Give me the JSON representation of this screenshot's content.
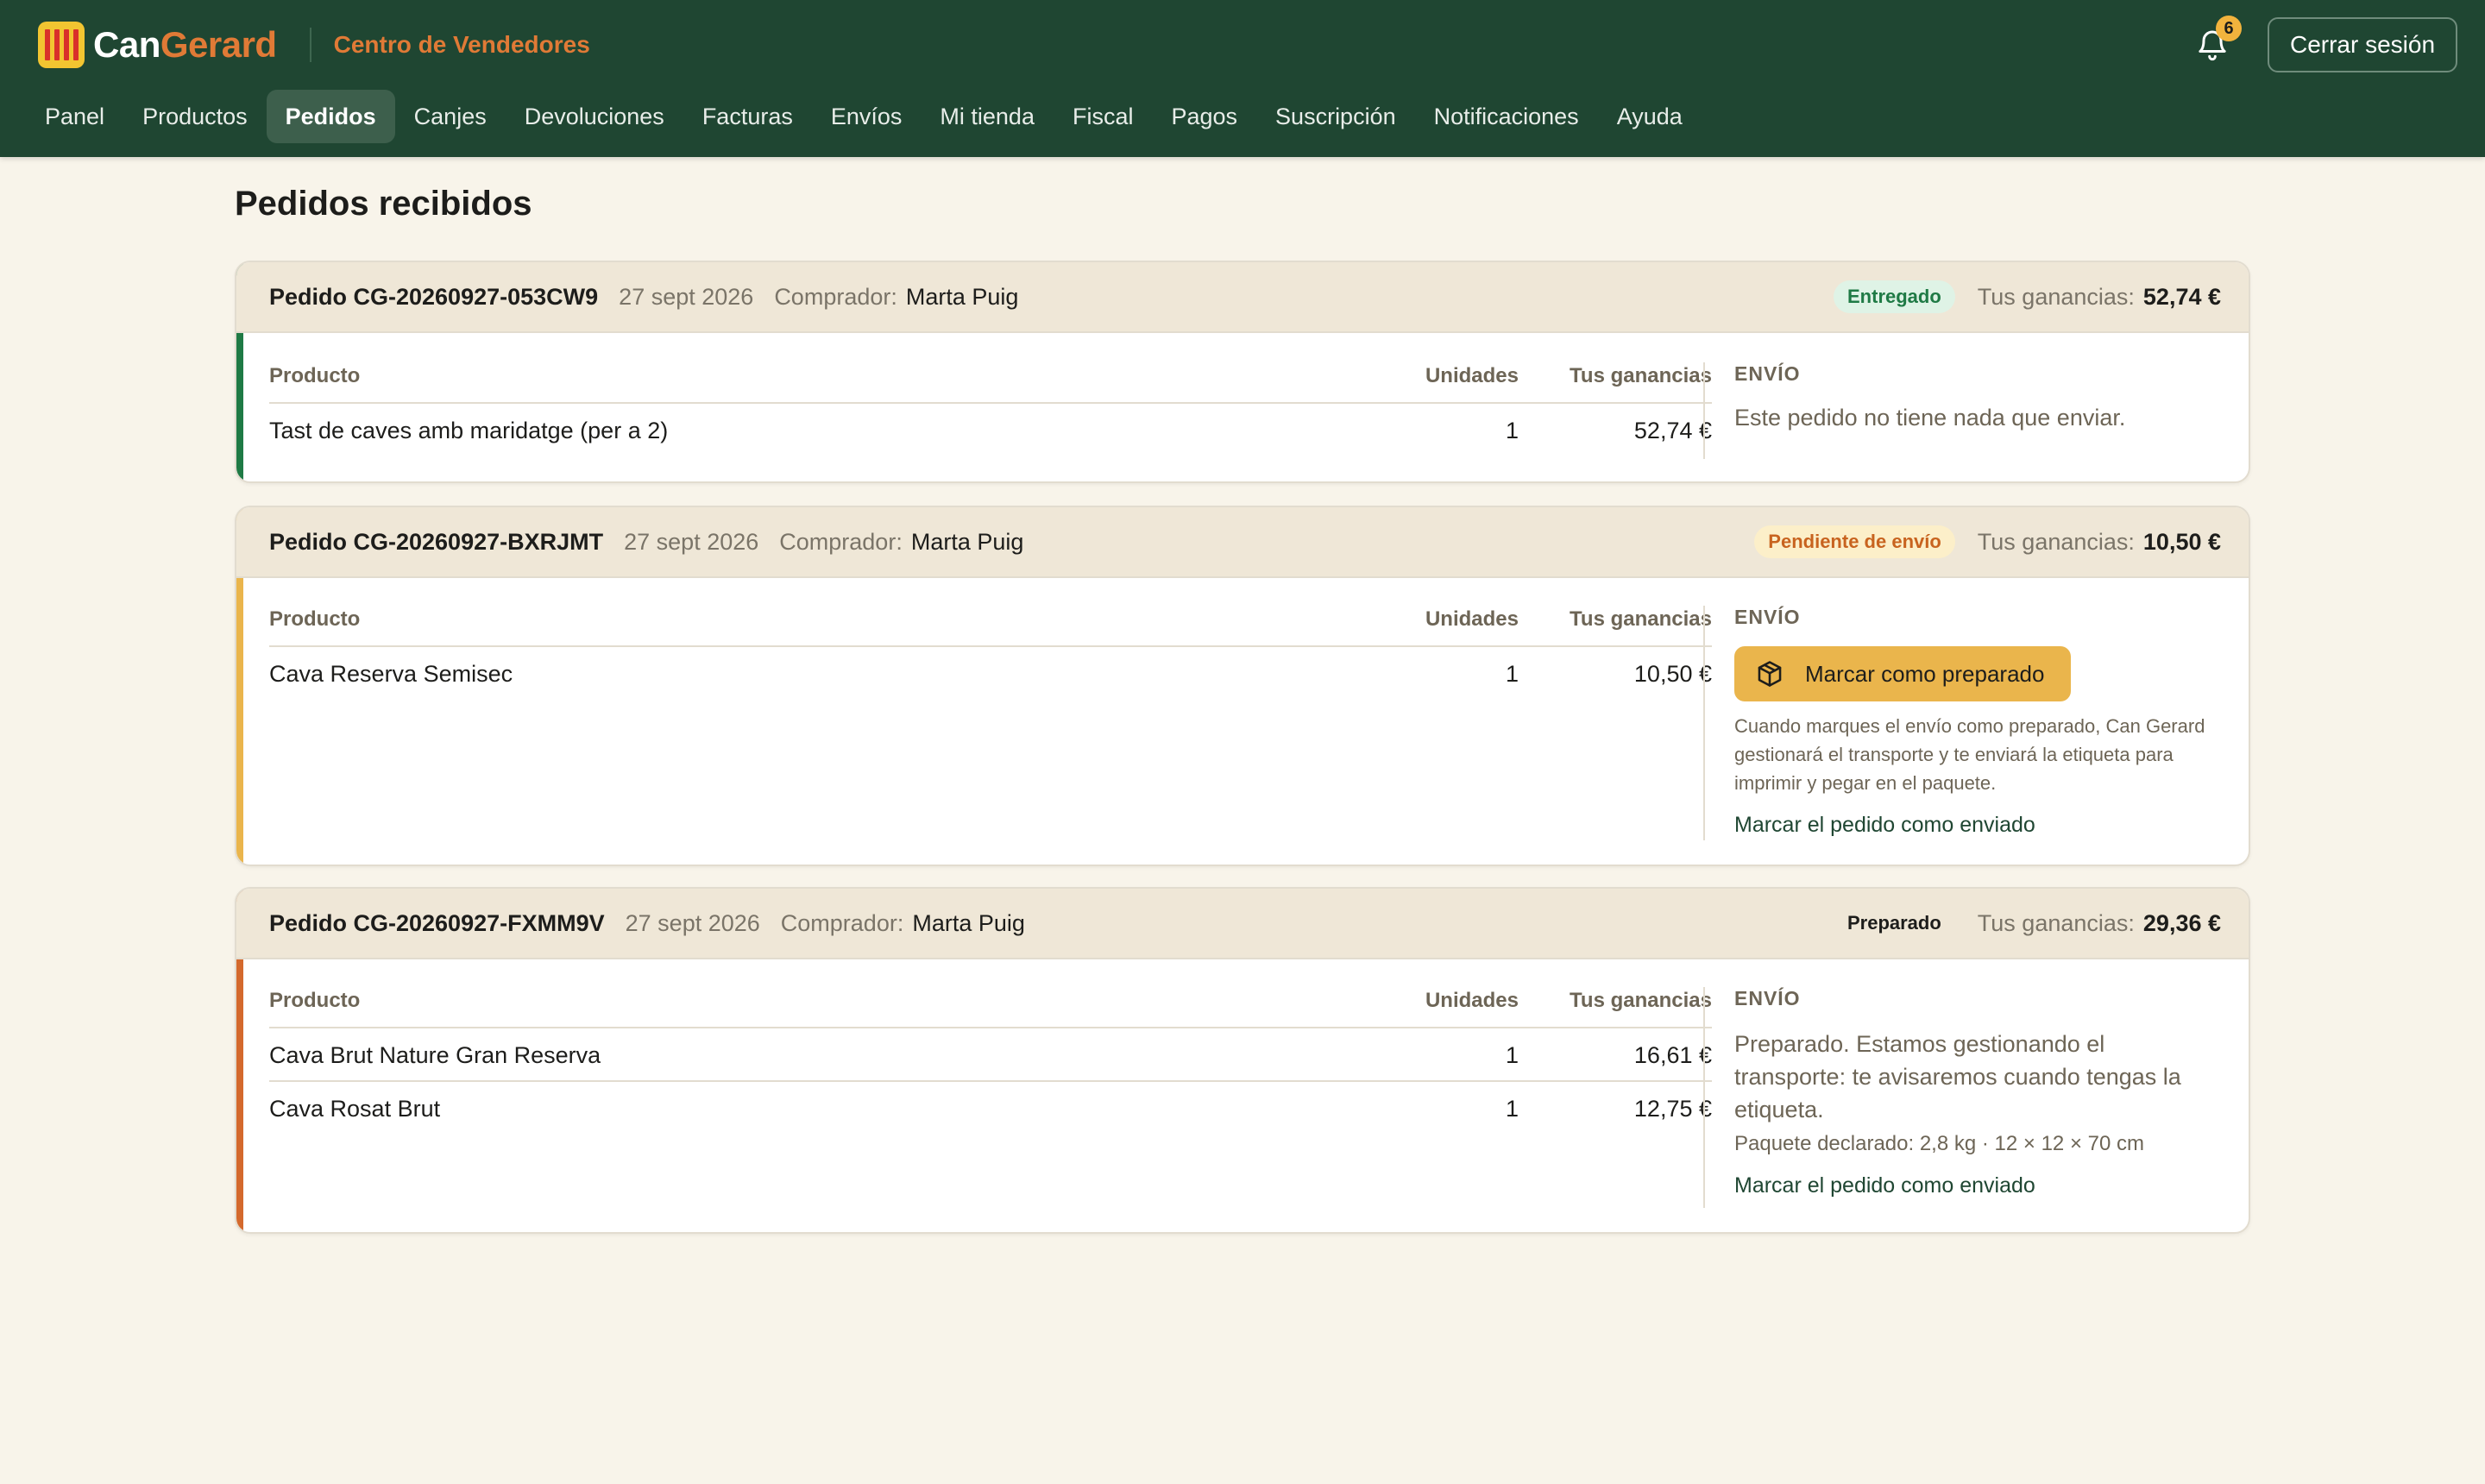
{
  "header": {
    "brand_a": "Can",
    "brand_b": "Gerard",
    "subtitle": "Centro de Vendedores",
    "notifications_count": "6",
    "logout_label": "Cerrar sesión",
    "nav": [
      "Panel",
      "Productos",
      "Pedidos",
      "Canjes",
      "Devoluciones",
      "Facturas",
      "Envíos",
      "Mi tienda",
      "Fiscal",
      "Pagos",
      "Suscripción",
      "Notificaciones",
      "Ayuda"
    ],
    "active_nav": "Pedidos"
  },
  "page_title": "Pedidos recibidos",
  "labels": {
    "buyer": "Comprador:",
    "earnings": "Tus ganancias:",
    "col_product": "Producto",
    "col_units": "Unidades",
    "col_earnings": "Tus ganancias",
    "shipping": "ENVÍO"
  },
  "orders": [
    {
      "id": "Pedido CG-20260927-053CW9",
      "date": "27 sept 2026",
      "buyer": "Marta Puig",
      "status": "Entregado",
      "status_color": "#1f7a45",
      "status_bg": "#dff3e6",
      "accent": "#1f7a45",
      "earnings": "52,74 €",
      "items": [
        {
          "product": "Tast de caves amb maridatge (per a 2)",
          "units": "1",
          "earnings": "52,74 €"
        }
      ],
      "shipping_text": "Este pedido no tiene nada que enviar."
    },
    {
      "id": "Pedido CG-20260927-BXRJMT",
      "date": "27 sept 2026",
      "buyer": "Marta Puig",
      "status": "Pendiente de envío",
      "status_color": "#c8631f",
      "status_bg": "#fcefc9",
      "accent": "#eab54c",
      "earnings": "10,50 €",
      "items": [
        {
          "product": "Cava Reserva Semisec",
          "units": "1",
          "earnings": "10,50 €"
        }
      ],
      "prepare_button": "Marcar como preparado",
      "shipping_help": "Cuando marques el envío como preparado, Can Gerard gestionará el transporte y te enviará la etiqueta para imprimir y pegar en el paquete.",
      "mark_sent": "Marcar el pedido como enviado"
    },
    {
      "id": "Pedido CG-20260927-FXMM9V",
      "date": "27 sept 2026",
      "buyer": "Marta Puig",
      "status": "Preparado",
      "status_color": "#1d1d1b",
      "status_bg": "transparent",
      "accent": "#d4692d",
      "earnings": "29,36 €",
      "items": [
        {
          "product": "Cava Brut Nature Gran Reserva",
          "units": "1",
          "earnings": "16,61 €"
        },
        {
          "product": "Cava Rosat Brut",
          "units": "1",
          "earnings": "12,75 €"
        }
      ],
      "shipping_text": "Preparado. Estamos gestionando el transporte: te avisaremos cuando tengas la etiqueta.",
      "package_info": "Paquete declarado: 2,8 kg · 12 × 12 × 70 cm",
      "mark_sent": "Marcar el pedido como enviado"
    }
  ]
}
